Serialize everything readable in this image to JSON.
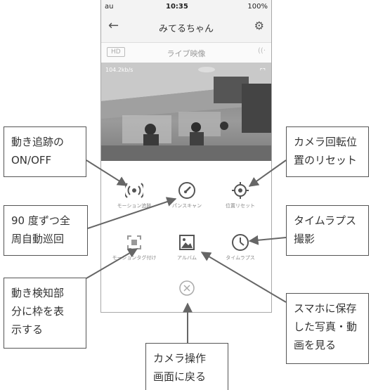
{
  "status_bar": {
    "left": "au",
    "time": "10:35",
    "right": "100%"
  },
  "nav": {
    "title": "みてるちゃん",
    "back_icon": "arrow-left-icon",
    "settings_icon": "gear-icon"
  },
  "quality_bar": {
    "hd_label": "HD",
    "live_label": "ライブ映像"
  },
  "video": {
    "bitrate": "104.2kb/s"
  },
  "controls": [
    {
      "label": "モーション追跡",
      "icon": "motion-tracking-icon"
    },
    {
      "label": "パンスキャン",
      "icon": "pan-scan-icon"
    },
    {
      "label": "位置リセット",
      "icon": "position-reset-icon"
    },
    {
      "label": "モーションタグ付け",
      "icon": "motion-tag-icon"
    },
    {
      "label": "アルバム",
      "icon": "album-icon"
    },
    {
      "label": "タイムラプス",
      "icon": "timelapse-icon"
    },
    {
      "label": "",
      "icon": "close-icon"
    }
  ],
  "callouts": {
    "motion_tracking": "動き追跡の\nON/OFF",
    "position_reset": "カメラ回転位\n置のリセット",
    "pan_scan": "90 度ずつ全\n周自動巡回",
    "timelapse": "タイムラプス\n撮影",
    "motion_tag": "動き検知部\n分に枠を表\n示する",
    "album": "スマホに保存\nした写真・動\n画を見る",
    "close": "カメラ操作\n画面に戻る"
  }
}
